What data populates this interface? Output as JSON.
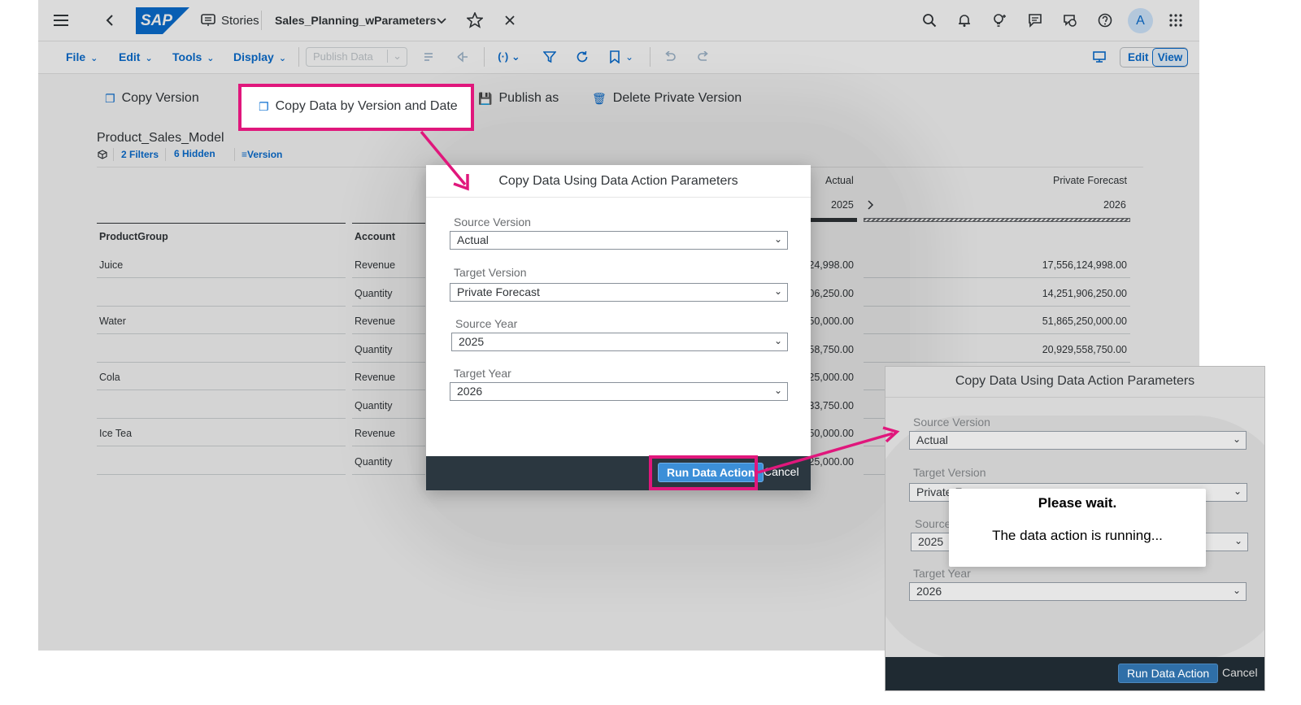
{
  "shell": {
    "brand": "SAP",
    "stories_label": "Stories",
    "story_title": "Sales_Planning_wParameters",
    "avatar_initial": "A"
  },
  "toolbar": {
    "menus": [
      "File",
      "Edit",
      "Tools",
      "Display"
    ],
    "publish_data_label": "Publish Data",
    "edit_label": "Edit",
    "view_label": "View"
  },
  "version_actions": {
    "copy_version": "Copy Version",
    "copy_data_by_version": "Copy Data by Version and Date",
    "publish_as": "Publish as",
    "delete_private": "Delete Private Version"
  },
  "table": {
    "model_name": "Product_Sales_Model",
    "filters_label": "2 Filters",
    "hidden_label": "6 Hidden",
    "version_label": "Version",
    "col_productgroup": "ProductGroup",
    "col_account": "Account",
    "actual_header": "Actual",
    "actual_year": "2025",
    "forecast_header": "Private Forecast",
    "forecast_year": "2026",
    "rows": [
      {
        "group": "Juice",
        "account": "Revenue",
        "actual": "24,998.00",
        "forecast": "17,556,124,998.00"
      },
      {
        "group": "",
        "account": "Quantity",
        "actual": "06,250.00",
        "forecast": "14,251,906,250.00"
      },
      {
        "group": "Water",
        "account": "Revenue",
        "actual": "50,000.00",
        "forecast": "51,865,250,000.00"
      },
      {
        "group": "",
        "account": "Quantity",
        "actual": "58,750.00",
        "forecast": "20,929,558,750.00"
      },
      {
        "group": "Cola",
        "account": "Revenue",
        "actual": "25,000.00",
        "forecast": ""
      },
      {
        "group": "",
        "account": "Quantity",
        "actual": "33,750.00",
        "forecast": ""
      },
      {
        "group": "Ice Tea",
        "account": "Revenue",
        "actual": "50,000.00",
        "forecast": ""
      },
      {
        "group": "",
        "account": "Quantity",
        "actual": "25,000.00",
        "forecast": ""
      }
    ]
  },
  "dialog": {
    "title": "Copy Data Using Data Action Parameters",
    "source_version_label": "Source Version",
    "source_version_value": "Actual",
    "target_version_label": "Target Version",
    "target_version_value": "Private Forecast",
    "source_year_label": "Source Year",
    "source_year_value": "2025",
    "target_year_label": "Target Year",
    "target_year_value": "2026",
    "run_label": "Run Data Action",
    "cancel_label": "Cancel"
  },
  "dialog2": {
    "title": "Copy Data Using Data Action Parameters",
    "source_version_label": "Source Version",
    "source_version_value": "Actual",
    "target_version_label": "Target Version",
    "target_version_value": "Private F",
    "source_year_label": "Source",
    "source_year_value": "2025",
    "target_year_label": "Target Year",
    "target_year_value": "2026",
    "run_label": "Run Data Action",
    "cancel_label": "Cancel",
    "busy_title": "Please wait.",
    "busy_message": "The data action is running..."
  },
  "colors": {
    "highlight": "#e0177c",
    "sap_blue": "#0a6ed1",
    "footer_dark": "#2b3740"
  }
}
